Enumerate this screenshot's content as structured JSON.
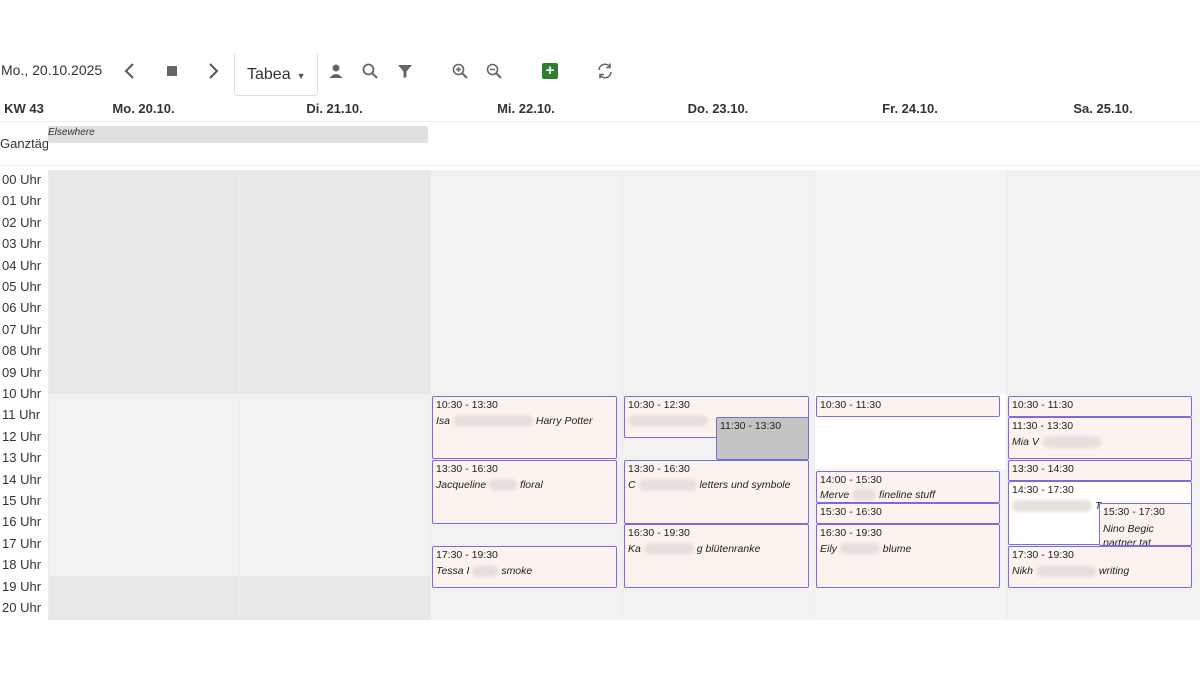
{
  "toolbar": {
    "date": "Mo., 20.10.2025",
    "resource": "Tabea",
    "add": "+"
  },
  "calendar": {
    "week": "KW 43",
    "days": [
      "Mo. 20.10.",
      "Di. 21.10.",
      "Mi. 22.10.",
      "Do. 23.10.",
      "Fr. 24.10.",
      "Sa. 25.10."
    ],
    "allday_label": "Ganztägig",
    "allday_event": "Elsewhere",
    "hours": [
      "00 Uhr",
      "01 Uhr",
      "02 Uhr",
      "03 Uhr",
      "04 Uhr",
      "05 Uhr",
      "06 Uhr",
      "07 Uhr",
      "08 Uhr",
      "09 Uhr",
      "10 Uhr",
      "11 Uhr",
      "12 Uhr",
      "13 Uhr",
      "14 Uhr",
      "15 Uhr",
      "16 Uhr",
      "17 Uhr",
      "18 Uhr",
      "19 Uhr",
      "20 Uhr"
    ]
  },
  "events": {
    "wed1": {
      "time": "10:30 - 13:30",
      "name1": "Isa",
      "name2": "Harry Potter"
    },
    "wed2": {
      "time": "13:30 - 16:30",
      "name1": "Jacqueline",
      "name2": "floral"
    },
    "wed3": {
      "time": "17:30 - 19:30",
      "name1": "Tessa I",
      "name2": "smoke"
    },
    "thu1": {
      "time": "10:30 - 12:30"
    },
    "thu2": {
      "time": "11:30 - 13:30"
    },
    "thu3": {
      "time": "13:30 - 16:30",
      "name1": "C",
      "name2": "letters und symbole"
    },
    "thu4": {
      "time": "16:30 - 19:30",
      "name1": "Ka",
      "name2": "g blütenranke"
    },
    "fri1": {
      "time": "10:30 - 11:30"
    },
    "fri2": {
      "time": "14:00 - 15:30",
      "name1": "Merve",
      "name2": "fineline stuff"
    },
    "fri3": {
      "time": "15:30 - 16:30"
    },
    "fri4": {
      "time": "16:30 - 19:30",
      "name1": "Eily",
      "name2": "blume"
    },
    "sat1": {
      "time": "10:30 - 11:30"
    },
    "sat2": {
      "time": "11:30 - 13:30",
      "name1": "Mia V"
    },
    "sat3": {
      "time": "13:30 - 14:30"
    },
    "sat4": {
      "time": "14:30 - 17:30",
      "name2": "T"
    },
    "sat5": {
      "time": "15:30 - 17:30",
      "name1": "Nino Begic",
      "name2": "partner tat"
    },
    "sat6": {
      "time": "17:30 - 19:30",
      "name1": "Nikh",
      "name2": "writing"
    }
  },
  "icons": [
    "chevron-left-icon",
    "stop-icon",
    "chevron-right-icon",
    "person-icon",
    "search-icon",
    "filter-icon",
    "zoom-in-icon",
    "zoom-out-icon",
    "add-icon",
    "refresh-icon"
  ]
}
